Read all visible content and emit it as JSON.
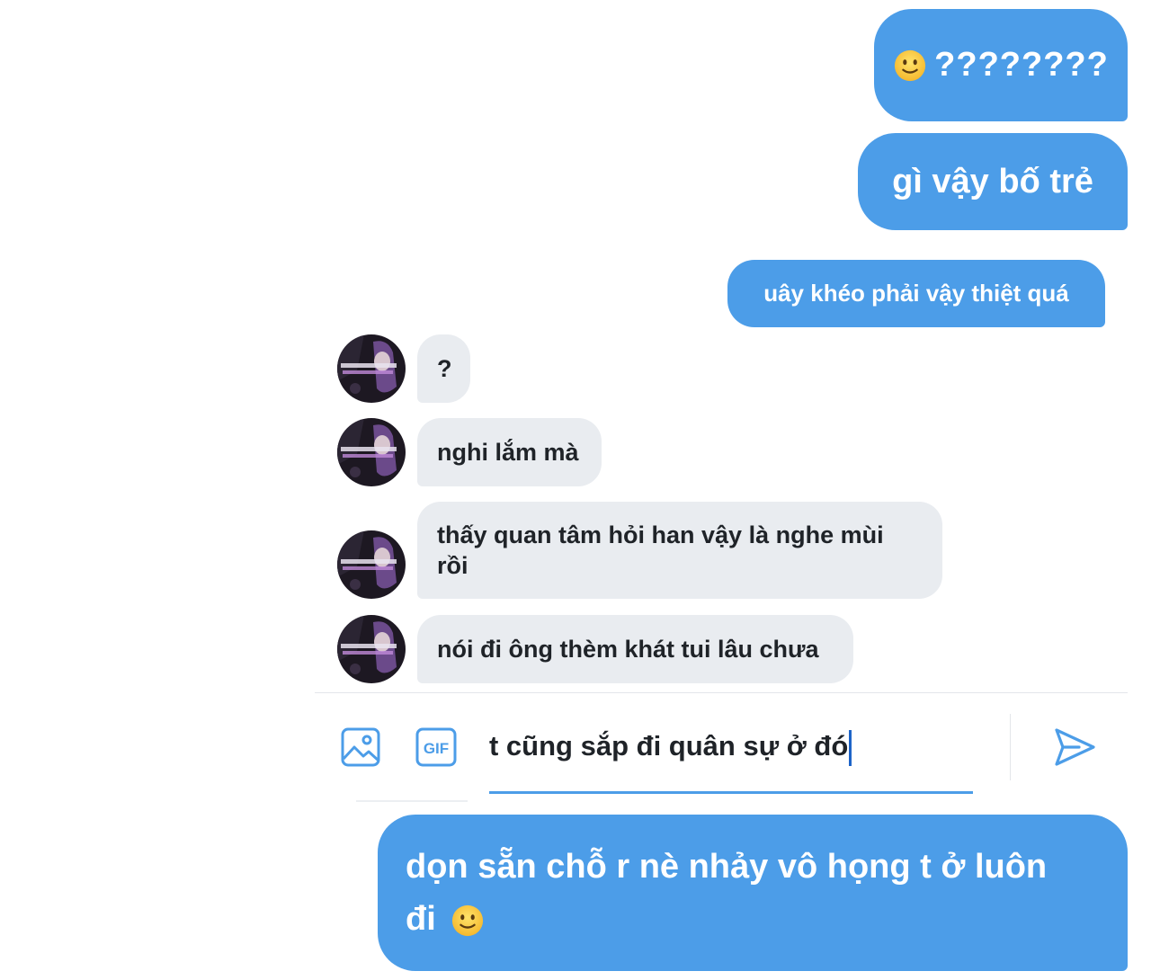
{
  "messages": {
    "out1": {
      "text": "????????",
      "emoji": "slightly-smiling-face"
    },
    "out2": {
      "text": "gì vậy bố trẻ"
    },
    "out3": {
      "text": "uây khéo phải vậy thiệt quá"
    },
    "in1": {
      "text": "?"
    },
    "in2": {
      "text": "nghi lắm mà"
    },
    "in3": {
      "text": "thấy quan tâm hỏi han vậy là nghe mùi rồi"
    },
    "in4": {
      "text": "nói đi ông thèm khát tui lâu chưa"
    },
    "out4": {
      "line1": "dọn sẵn chỗ r nè nhảy vô họng t ở luôn",
      "line2": "đi",
      "emoji": "slightly-smiling-face"
    }
  },
  "composer": {
    "input_value": "t cũng sắp đi quân sự ở đó",
    "gif_label": "GIF",
    "icons": [
      "image-icon",
      "gif-icon",
      "send-icon"
    ]
  },
  "colors": {
    "outgoing_bubble": "#4c9de8",
    "incoming_bubble": "#e9ecf0",
    "accent": "#4c9de8"
  }
}
